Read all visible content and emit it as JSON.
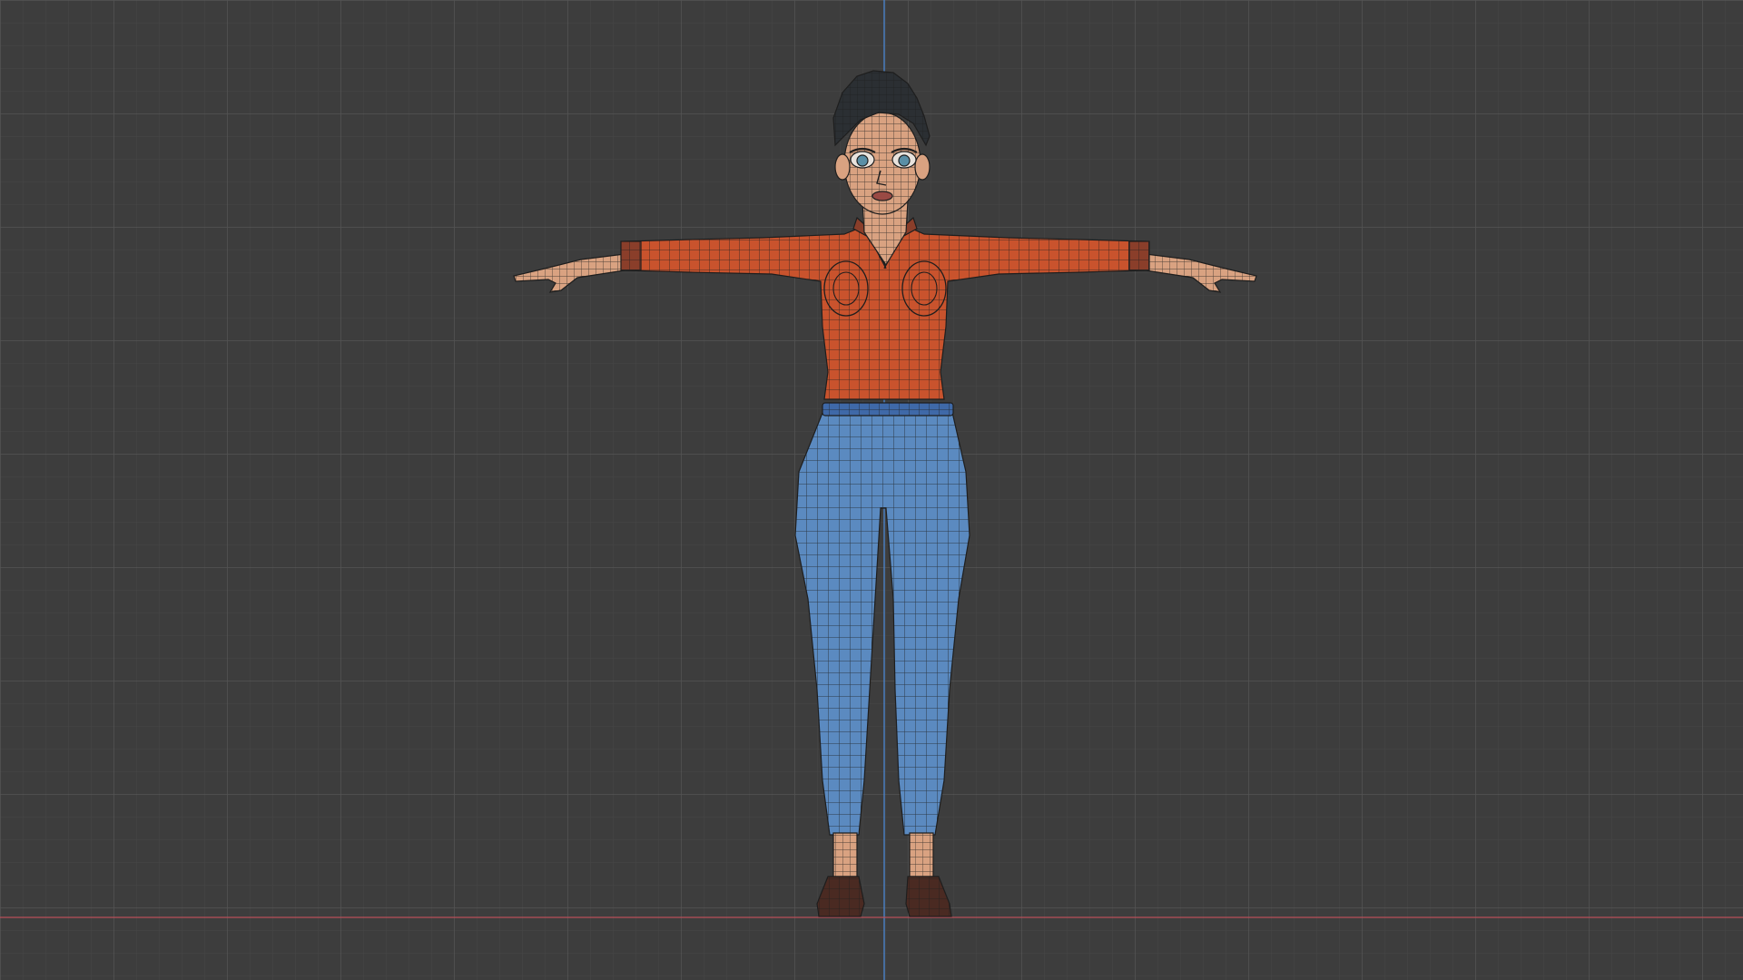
{
  "viewport": {
    "background_color": "#3d3d3d",
    "grid_minor_color": "#474747",
    "grid_major_color": "#545454",
    "x_axis_color": "#b8505a",
    "z_axis_color": "#4a82c8"
  },
  "character": {
    "pose": "T-pose",
    "display": "wireframe-over-solid",
    "colors": {
      "skin": "#d9a281",
      "shirt": "#c9532d",
      "shirt_cuff": "#8a3e2a",
      "pants": "#5b8ac0",
      "waistband": "#3f69a8",
      "hair": "#2b2f33",
      "shoes": "#4a2a22",
      "eyes": "#5a8fa6",
      "lips": "#9a4a44",
      "wire": "#1e1e1e"
    }
  }
}
